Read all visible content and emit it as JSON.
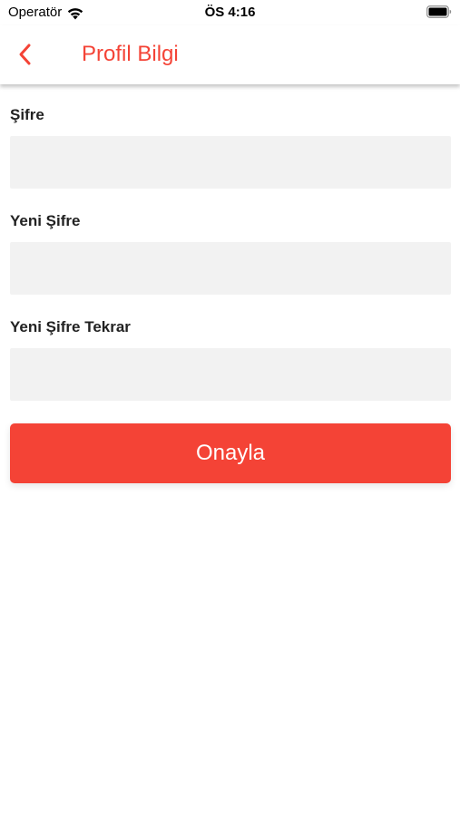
{
  "status_bar": {
    "carrier": "Operatör",
    "time": "ÖS 4:16",
    "wifi_icon": "wifi-icon",
    "battery_icon": "battery-icon"
  },
  "nav": {
    "back_icon": "chevron-left-icon",
    "title": "Profil Bilgi"
  },
  "form": {
    "fields": [
      {
        "label": "Şifre",
        "value": "",
        "placeholder": ""
      },
      {
        "label": "Yeni Şifre",
        "value": "",
        "placeholder": ""
      },
      {
        "label": "Yeni Şifre Tekrar",
        "value": "",
        "placeholder": ""
      }
    ],
    "submit_label": "Onayla"
  },
  "colors": {
    "accent": "#f44336",
    "input_background": "#f2f2f2",
    "label_text": "#222222"
  }
}
